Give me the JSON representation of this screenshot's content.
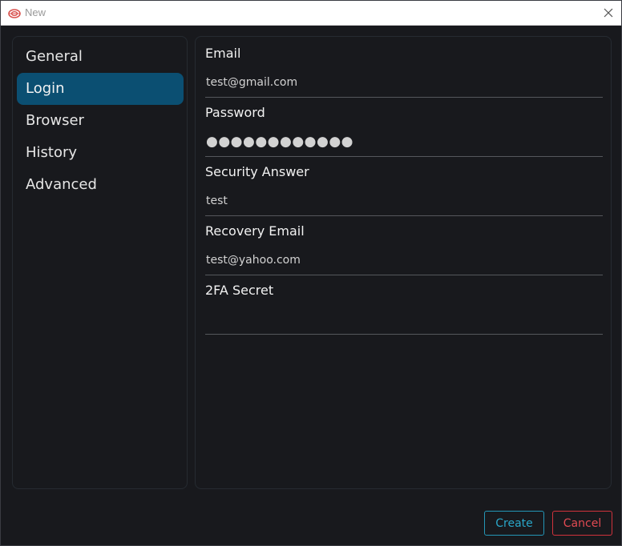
{
  "window": {
    "title": "New",
    "accent_color": "#0b4f72"
  },
  "sidebar": {
    "items": [
      {
        "label": "General",
        "active": false
      },
      {
        "label": "Login",
        "active": true
      },
      {
        "label": "Browser",
        "active": false
      },
      {
        "label": "History",
        "active": false
      },
      {
        "label": "Advanced",
        "active": false
      }
    ]
  },
  "form": {
    "fields": [
      {
        "label": "Email",
        "value": "test@gmail.com",
        "type": "text"
      },
      {
        "label": "Password",
        "value": "●●●●●●●●●●●●",
        "type": "password"
      },
      {
        "label": "Security Answer",
        "value": "test",
        "type": "text"
      },
      {
        "label": "Recovery Email",
        "value": "test@yahoo.com",
        "type": "text"
      },
      {
        "label": "2FA Secret",
        "value": "",
        "type": "text"
      }
    ]
  },
  "actions": {
    "create_label": "Create",
    "cancel_label": "Cancel",
    "create_color": "#2aa6c8",
    "cancel_color": "#e14a52"
  }
}
